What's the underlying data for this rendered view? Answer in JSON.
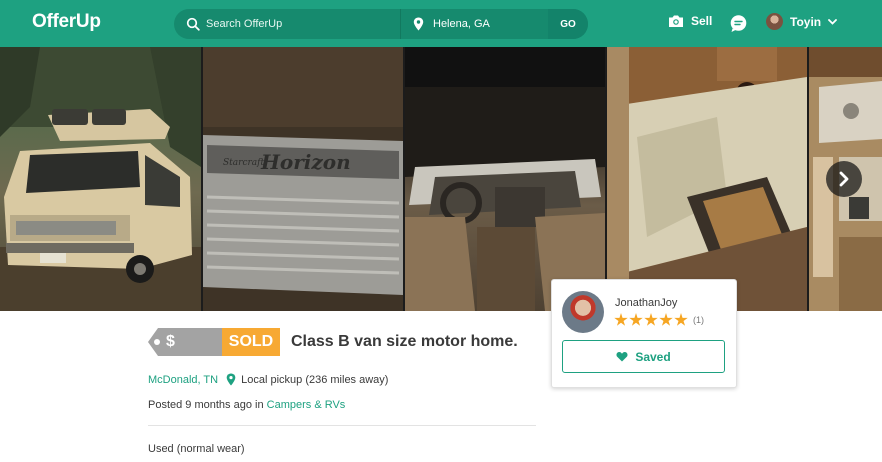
{
  "header": {
    "logo": "OfferUp",
    "search_placeholder": "Search OfferUp",
    "location_value": "Helena, GA",
    "go_label": "GO",
    "sell_label": "Sell",
    "user_name": "Toyin"
  },
  "gallery": {
    "photos": [
      "photo-van-exterior",
      "photo-horizon-badge",
      "photo-cab-interior",
      "photo-kitchen-counter",
      "photo-interior-cabin"
    ]
  },
  "listing": {
    "price_symbol": "$",
    "sold_label": "SOLD",
    "title": "Class B van size motor home.",
    "city": "McDonald, TN",
    "pickup": "Local pickup (236 miles away)",
    "posted_prefix": "Posted 9 months ago in",
    "category": "Campers & RVs",
    "condition": "Used (normal wear)"
  },
  "seller": {
    "name": "JonathanJoy",
    "rating_stars": 5,
    "rating_count": "(1)",
    "saved_label": "Saved"
  },
  "colors": {
    "brand": "#1ea181",
    "sold": "#f7a933",
    "star": "#f6a623"
  }
}
